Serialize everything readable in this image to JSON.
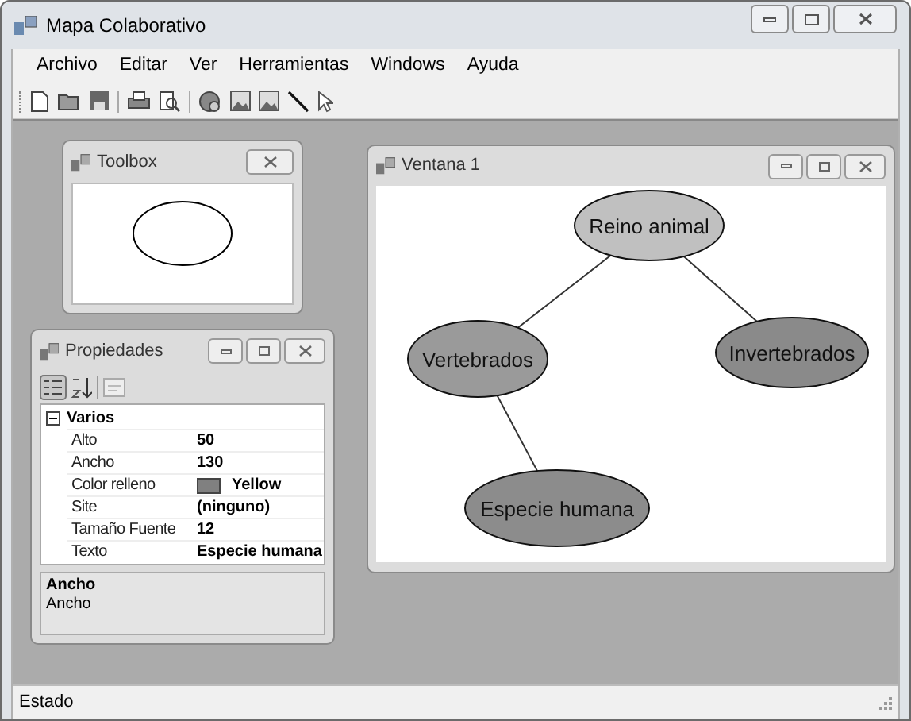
{
  "window": {
    "title": "Mapa Colaborativo"
  },
  "menu": [
    "Archivo",
    "Editar",
    "Ver",
    "Herramientas",
    "Windows",
    "Ayuda"
  ],
  "toolbox": {
    "title": "Toolbox"
  },
  "properties": {
    "title": "Propiedades",
    "category": {
      "label": "Varios",
      "expanded": true
    },
    "rows": [
      {
        "kind": "text",
        "name": "Alto",
        "value": "50"
      },
      {
        "kind": "text",
        "name": "Ancho",
        "value": "130"
      },
      {
        "kind": "color",
        "name": "Color relleno",
        "value": "Yellow",
        "color": "#808080"
      },
      {
        "kind": "text",
        "name": "Site",
        "value": "(ninguno)"
      },
      {
        "kind": "text",
        "name": "Tamaño Fuente",
        "value": "12"
      },
      {
        "kind": "text",
        "name": "Texto",
        "value": "Especie humana"
      }
    ],
    "description": {
      "title": "Ancho",
      "text": "Ancho"
    }
  },
  "document": {
    "title": "Ventana 1",
    "nodes": [
      {
        "label": "Reino animal",
        "color": "#c0c0c0",
        "children": [
          {
            "label": "Vertebrados",
            "color": "#9a9a9a",
            "children": [
              {
                "label": "Especie humana",
                "color": "#8c8c8c"
              }
            ]
          },
          {
            "label": "Invertebrados",
            "color": "#8a8a8a"
          }
        ]
      }
    ]
  },
  "status_bar": "Estado"
}
